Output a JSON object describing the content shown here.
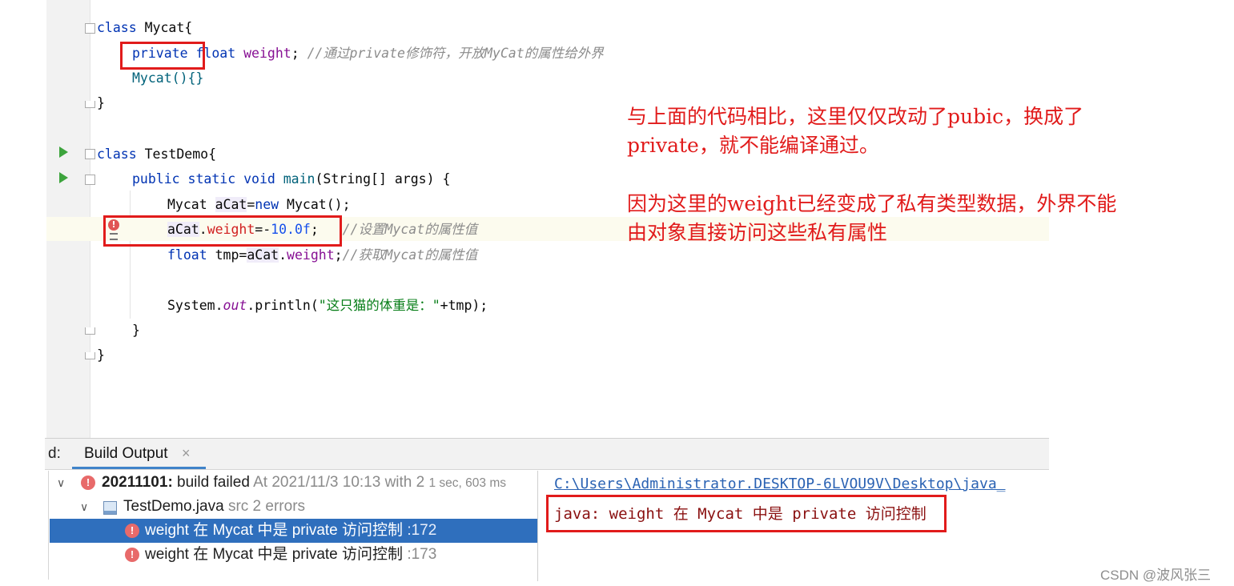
{
  "code": {
    "l1": {
      "kw": "class",
      "rest": " Mycat{"
    },
    "l2": {
      "kw1": "private",
      "kw2": "float",
      "field": "weight",
      "semi": ";",
      "comment": "//通过private修饰符，开放MyCat的属性给外界"
    },
    "l3": {
      "text": "Mycat(){}"
    },
    "l4": {
      "text": "}"
    },
    "l5": {
      "kw": "class",
      "rest": " TestDemo{"
    },
    "l6": {
      "kw": "public static void",
      "method": "main",
      "rest": "(String[] args) {"
    },
    "l7": {
      "a": "Mycat ",
      "var": "aCat",
      "eq": "=",
      "kw": "new",
      "rest": " Mycat();"
    },
    "l8": {
      "var": "aCat",
      "dot": ".",
      "field": "weight",
      "eq": "=-",
      "num": "10.0f",
      "semi": ";",
      "comment": "//设置Mycat的属性值"
    },
    "l9": {
      "kw": "float",
      "a": " tmp=",
      "var": "aCat",
      "dot": ".",
      "field": "weight",
      "semi": ";",
      "comment": "//获取Mycat的属性值"
    },
    "l10": {
      "a": "System.",
      "out": "out",
      "b": ".println(",
      "str": "\"这只猫的体重是：\"",
      "c": "+tmp);"
    },
    "l11": {
      "text": "}"
    },
    "l12": {
      "text": "}"
    }
  },
  "annotation": {
    "line1": "与上面的代码相比，这里仅仅改动了pubic，换成了",
    "line2": "private，就不能编译通过。",
    "line3": "因为这里的weight已经变成了私有类型数据，外界不能",
    "line4": "由对象直接访问这些私有属性"
  },
  "build_panel": {
    "tab_prefix": "d:",
    "tab_label": "Build Output",
    "tab_close": "×",
    "tree": {
      "root": {
        "name": "20211101:",
        "status": "build failed",
        "time": "At 2021/11/3 10:13 with 2",
        "duration": "1 sec, 603 ms"
      },
      "file": {
        "name": "TestDemo.java",
        "meta": "src 2 errors"
      },
      "errors": [
        {
          "message": "weight 在 Mycat 中是 private 访问控制",
          "line": ":172"
        },
        {
          "message": "weight 在 Mycat 中是 private 访问控制",
          "line": ":173"
        }
      ]
    },
    "detail": {
      "path": "C:\\Users\\Administrator.DESKTOP-6LVOU9V\\Desktop\\java_",
      "message": "java: weight 在 Mycat 中是 private 访问控制"
    }
  },
  "watermark": "CSDN @波风张三",
  "colors": {
    "annotation_red": "#e11b1b",
    "selection_blue": "#2f6fbd",
    "keyword_blue": "#0033b3"
  }
}
